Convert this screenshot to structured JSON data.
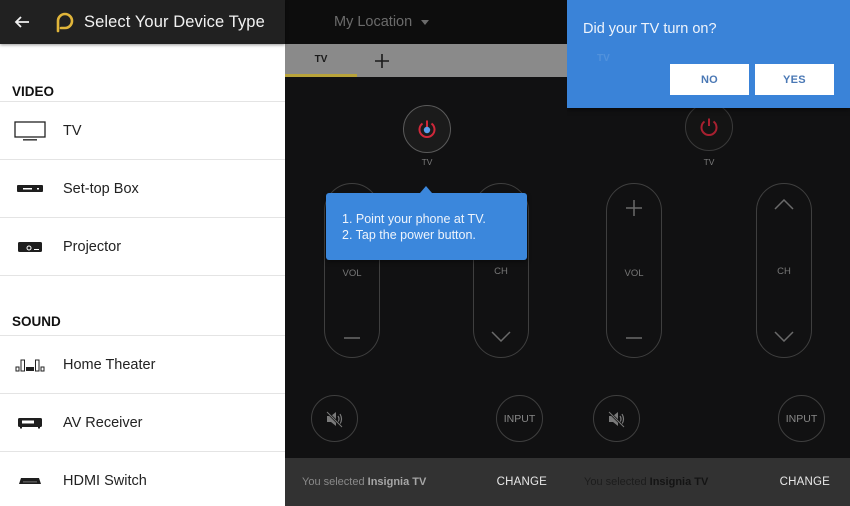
{
  "device_type_screen": {
    "title": "Select Your Device Type",
    "back_icon": "arrow-left-icon",
    "logo_icon": "peel-logo-icon",
    "sections": [
      {
        "header": "VIDEO",
        "items": [
          {
            "label": "TV",
            "icon": "tv-icon"
          },
          {
            "label": "Set-top Box",
            "icon": "set-top-box-icon"
          },
          {
            "label": "Projector",
            "icon": "projector-icon"
          }
        ]
      },
      {
        "header": "SOUND",
        "items": [
          {
            "label": "Home Theater",
            "icon": "home-theater-icon"
          },
          {
            "label": "AV Receiver",
            "icon": "av-receiver-icon"
          },
          {
            "label": "HDMI Switch",
            "icon": "hdmi-switch-icon"
          }
        ]
      }
    ]
  },
  "remote_screen": {
    "location": "My Location",
    "tabs": [
      {
        "label": "TV",
        "active": true
      }
    ],
    "add_tab_icon": "plus-icon",
    "power_label": "TV",
    "vol_label": "VOL",
    "ch_label": "CH",
    "input_label": "INPUT",
    "mute_icon": "mute-icon",
    "tooltip": {
      "line1": "1. Point your phone at TV.",
      "line2": "2. Tap the power button."
    },
    "bottom": {
      "prefix": "You selected ",
      "device": "Insignia TV",
      "change_label": "CHANGE"
    }
  },
  "confirm_screen": {
    "question": "Did your TV turn on?",
    "no_label": "NO",
    "yes_label": "YES",
    "ghost_tab": "TV",
    "power_label": "TV",
    "vol_label": "VOL",
    "ch_label": "CH",
    "input_label": "INPUT",
    "bottom": {
      "prefix": "You selected ",
      "device": "Insignia TV",
      "change_label": "CHANGE"
    }
  },
  "colors": {
    "accent_blue": "#3b87dc",
    "power_red": "#d0283a",
    "tab_underline": "#b8a33a",
    "logo_gold": "#e0b53a"
  }
}
